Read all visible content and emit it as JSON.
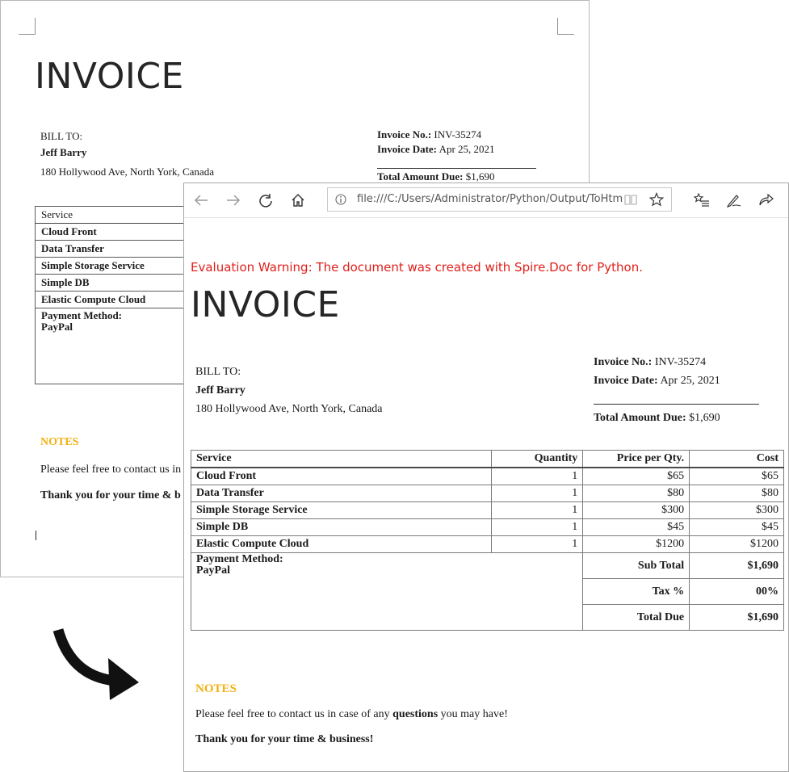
{
  "doc": {
    "title": "INVOICE",
    "bill_to_label": "BILL TO:",
    "customer_name": "Jeff Barry",
    "customer_address": "180 Hollywood Ave, North York, Canada",
    "invoice_no_label": "Invoice No.:",
    "invoice_no": "INV-35274",
    "invoice_date_label": "Invoice Date:",
    "invoice_date": "Apr 25, 2021",
    "total_due_label": "Total Amount Due:",
    "total_due": "$1,690",
    "table": {
      "header": "Service",
      "rows": [
        "Cloud Front",
        "Data Transfer",
        "Simple Storage Service",
        "Simple DB",
        "Elastic Compute Cloud"
      ],
      "payment_label": "Payment Method:",
      "payment_value": "PayPal"
    },
    "notes_title": "NOTES",
    "notes_line": "Please feel free to contact us in",
    "thanks_line": "Thank you for your time & b"
  },
  "browser": {
    "url": "file:///C:/Users/Administrator/Python/Output/ToHtml.html"
  },
  "page": {
    "warning": "Evaluation Warning: The document was created with Spire.Doc for Python.",
    "title": "INVOICE",
    "bill_to_label": "BILL TO:",
    "customer_name": "Jeff Barry",
    "customer_address": "180 Hollywood Ave, North York, Canada",
    "invoice_no_label": "Invoice No.:",
    "invoice_no": "INV-35274",
    "invoice_date_label": "Invoice Date:",
    "invoice_date": "Apr 25, 2021",
    "total_due_label": "Total Amount Due:",
    "total_due": "$1,690",
    "table": {
      "headers": [
        "Service",
        "Quantity",
        "Price per Qty.",
        "Cost"
      ],
      "rows": [
        {
          "service": "Cloud Front",
          "qty": "1",
          "price": "$65",
          "cost": "$65"
        },
        {
          "service": "Data Transfer",
          "qty": "1",
          "price": "$80",
          "cost": "$80"
        },
        {
          "service": "Simple Storage Service",
          "qty": "1",
          "price": "$300",
          "cost": "$300"
        },
        {
          "service": "Simple DB",
          "qty": "1",
          "price": "$45",
          "cost": "$45"
        },
        {
          "service": "Elastic Compute Cloud",
          "qty": "1",
          "price": "$1200",
          "cost": "$1200"
        }
      ],
      "payment_label": "Payment Method:",
      "payment_value": "PayPal",
      "totals": [
        {
          "label": "Sub Total",
          "value": "$1,690"
        },
        {
          "label": "Tax %",
          "value": "00%"
        },
        {
          "label": "Total Due",
          "value": "$1,690"
        }
      ]
    },
    "notes_title": "NOTES",
    "notes_pre": "Please feel free to contact us in case of any ",
    "notes_bold": "questions",
    "notes_post": " you may have!",
    "thanks": "Thank you for your time & business!"
  },
  "icons": {
    "back": "back-arrow-icon",
    "forward": "forward-arrow-icon",
    "refresh": "refresh-icon",
    "home": "home-icon",
    "info": "info-icon",
    "reading_view": "reading-view-icon",
    "favorite": "star-icon",
    "favorites_list": "favorites-list-icon",
    "pen": "pen-icon",
    "share": "share-icon",
    "arrow": "curved-arrow-icon"
  }
}
